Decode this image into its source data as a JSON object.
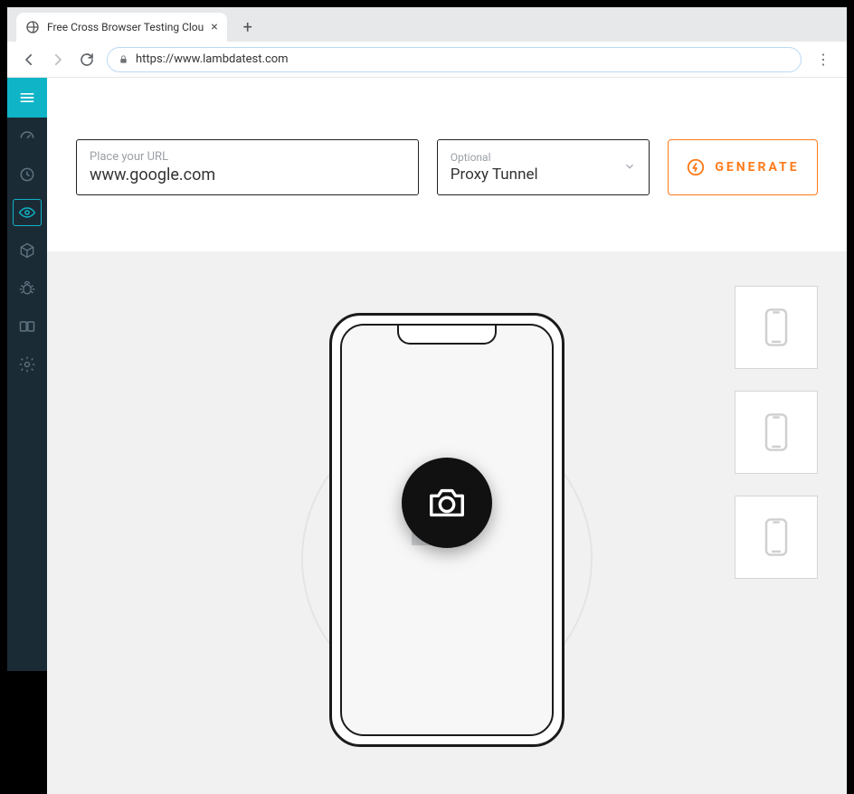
{
  "browser": {
    "tab_title": "Free Cross Browser Testing Clou",
    "url": "https://www.lambdatest.com"
  },
  "sidebar": {
    "items": [
      {
        "id": "hamburger"
      },
      {
        "id": "dashboard"
      },
      {
        "id": "history"
      },
      {
        "id": "visual",
        "active": true
      },
      {
        "id": "box3d"
      },
      {
        "id": "bug"
      },
      {
        "id": "compare"
      },
      {
        "id": "settings"
      }
    ]
  },
  "form": {
    "url": {
      "label": "Place your URL",
      "value": "www.google.com"
    },
    "proxy": {
      "label": "Optional",
      "value": "Proxy Tunnel"
    },
    "generate_label": "GENERATE"
  },
  "preview": {
    "device_os": "apple"
  },
  "device_list": {
    "count": 3
  }
}
